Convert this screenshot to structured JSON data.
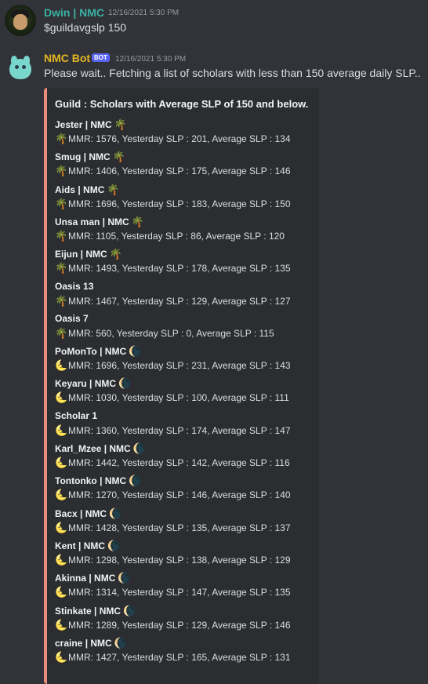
{
  "messages": [
    {
      "username": "Dwin  | NMC",
      "username_color": "#3ab0a3",
      "timestamp": "12/16/2021 5:30 PM",
      "text": "$guildavgslp 150"
    },
    {
      "username": "NMC Bot",
      "username_color": "#e4b622",
      "badge": "BOT",
      "timestamp": "12/16/2021 5:30 PM",
      "text": "Please wait.. Fetching a list of scholars with less than 150 average daily SLP..",
      "embed": {
        "title": "Guild : Scholars with Average SLP of 150 and below.",
        "accent_color": "#ea8c7c",
        "entries": [
          {
            "name": "Jester | NMC",
            "icon": "🌴",
            "stats": "MMR: 1576, Yesterday SLP : 201, Average SLP : 134"
          },
          {
            "name": "Smug | NMC",
            "icon": "🌴",
            "stats": "MMR: 1406, Yesterday SLP : 175, Average SLP : 146"
          },
          {
            "name": "Aids | NMC",
            "icon": "🌴",
            "stats": "MMR: 1696, Yesterday SLP : 183, Average SLP : 150"
          },
          {
            "name": "Unsa man | NMC",
            "icon": "🌴",
            "stats": "MMR: 1105, Yesterday SLP : 86, Average SLP : 120"
          },
          {
            "name": "Eijun | NMC",
            "icon": "🌴",
            "stats": "MMR: 1493, Yesterday SLP : 178, Average SLP : 135"
          },
          {
            "name": "Oasis 13",
            "icon": "",
            "stats": "MMR: 1467, Yesterday SLP : 129, Average SLP : 127",
            "stat_icon": "🌴"
          },
          {
            "name": "Oasis 7",
            "icon": "",
            "stats": "MMR: 560, Yesterday SLP : 0, Average SLP : 115",
            "stat_icon": "🌴"
          },
          {
            "name": "PoMonTo | NMC",
            "icon": "🌘",
            "stats": "MMR: 1696, Yesterday SLP : 231, Average SLP : 143"
          },
          {
            "name": "Keyaru | NMC",
            "icon": "🌘",
            "stats": "MMR: 1030, Yesterday SLP : 100, Average SLP : 111"
          },
          {
            "name": "Scholar 1",
            "icon": "",
            "stats": "MMR: 1360, Yesterday SLP : 174, Average SLP : 147",
            "stat_icon": "🌜"
          },
          {
            "name": "Karl_Mzee | NMC",
            "icon": "🌘",
            "stats": "MMR: 1442, Yesterday SLP : 142, Average SLP : 116"
          },
          {
            "name": "Tontonko | NMC",
            "icon": "🌘",
            "stats": "MMR: 1270, Yesterday SLP : 146, Average SLP : 140"
          },
          {
            "name": "Bacx | NMC",
            "icon": "🌘",
            "stats": "MMR: 1428, Yesterday SLP : 135, Average SLP : 137"
          },
          {
            "name": "Kent | NMC",
            "icon": "🌘",
            "stats": "MMR: 1298, Yesterday SLP : 138, Average SLP : 129"
          },
          {
            "name": "Akinna | NMC",
            "icon": "🌘",
            "stats": "MMR: 1314, Yesterday SLP : 147, Average SLP : 135"
          },
          {
            "name": "Stinkate | NMC",
            "icon": "🌘",
            "stats": "MMR: 1289, Yesterday SLP : 129, Average SLP : 146"
          },
          {
            "name": "craine | NMC",
            "icon": "🌘",
            "stats": "MMR: 1427, Yesterday SLP : 165, Average SLP : 131"
          }
        ]
      }
    }
  ]
}
